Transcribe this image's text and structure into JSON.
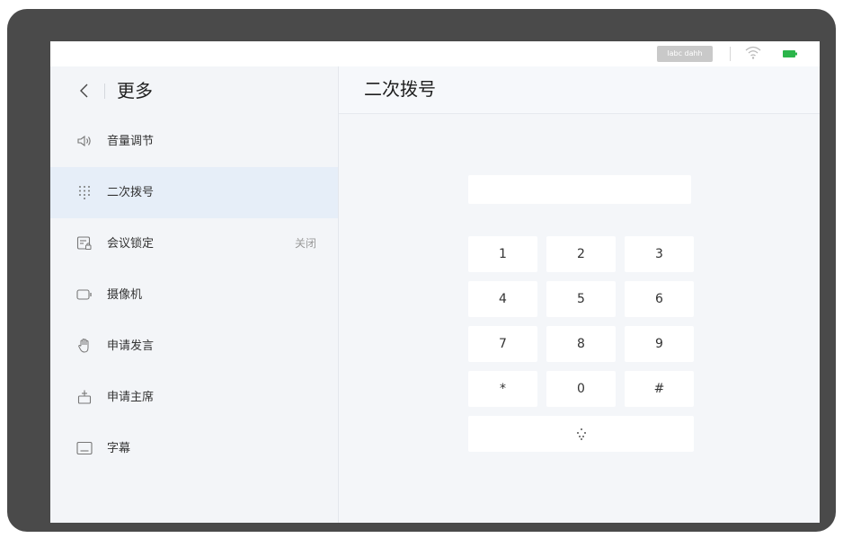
{
  "status_bar": {
    "badge": "labc dahh"
  },
  "sidebar": {
    "title": "更多",
    "items": [
      {
        "label": "音量调节",
        "icon": "volume-icon",
        "value": ""
      },
      {
        "label": "二次拨号",
        "icon": "dialpad-icon",
        "value": "",
        "active": true
      },
      {
        "label": "会议锁定",
        "icon": "lock-icon",
        "value": "关闭"
      },
      {
        "label": "摄像机",
        "icon": "camera-icon",
        "value": ""
      },
      {
        "label": "申请发言",
        "icon": "hand-icon",
        "value": ""
      },
      {
        "label": "申请主席",
        "icon": "chair-icon",
        "value": ""
      },
      {
        "label": "字幕",
        "icon": "subtitle-icon",
        "value": ""
      }
    ]
  },
  "main": {
    "title": "二次拨号",
    "input": {
      "value": "",
      "placeholder": ""
    },
    "keys": [
      "1",
      "2",
      "3",
      "4",
      "5",
      "6",
      "7",
      "8",
      "9",
      "*",
      "0",
      "#"
    ],
    "action_key_icon": "collapse-keypad-icon"
  }
}
